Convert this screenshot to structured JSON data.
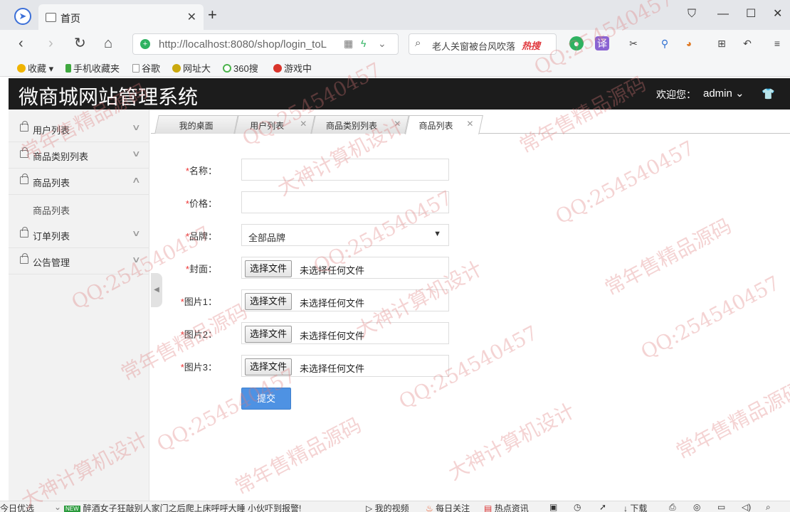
{
  "browser": {
    "tab_title": "首页",
    "url": "http://localhost:8080/shop/login_toL",
    "search_text": "老人关窗被台风吹落",
    "search_hot": "热搜",
    "bookmarks": [
      "收藏",
      "手机收藏夹",
      "谷歌",
      "网址大",
      "360搜",
      "游戏中"
    ]
  },
  "app": {
    "title": "微商城网站管理系统",
    "welcome": "欢迎您：",
    "user": "admin"
  },
  "sidebar": {
    "items": [
      {
        "label": "用户列表"
      },
      {
        "label": "商品类别列表"
      },
      {
        "label": "商品列表"
      },
      {
        "label": "订单列表"
      },
      {
        "label": "公告管理"
      }
    ],
    "submenu": "商品列表"
  },
  "tabs": [
    {
      "label": "我的桌面"
    },
    {
      "label": "用户列表"
    },
    {
      "label": "商品类别列表"
    },
    {
      "label": "商品列表"
    }
  ],
  "form": {
    "name_label": "名称：",
    "price_label": "价格：",
    "brand_label": "品牌：",
    "brand_value": "全部品牌",
    "cover_label": "封面：",
    "image1_label": "图片1：",
    "image2_label": "图片2：",
    "image3_label": "图片3：",
    "required_mark": "*",
    "file_button": "选择文件",
    "file_status": "未选择任何文件",
    "submit": "提交"
  },
  "statusbar": {
    "left": "今日优选",
    "news_badge": "NEW",
    "news": "醉酒女子狂敲别人家门之后爬上床呼呼大睡 小伙吓到报警!",
    "video": "我的视频",
    "follow": "每日关注",
    "hot_news": "热点资讯",
    "download": "下载"
  },
  "watermarks": [
    "QQ:254540457",
    "常年售精品源码",
    "大神计算机设计"
  ]
}
